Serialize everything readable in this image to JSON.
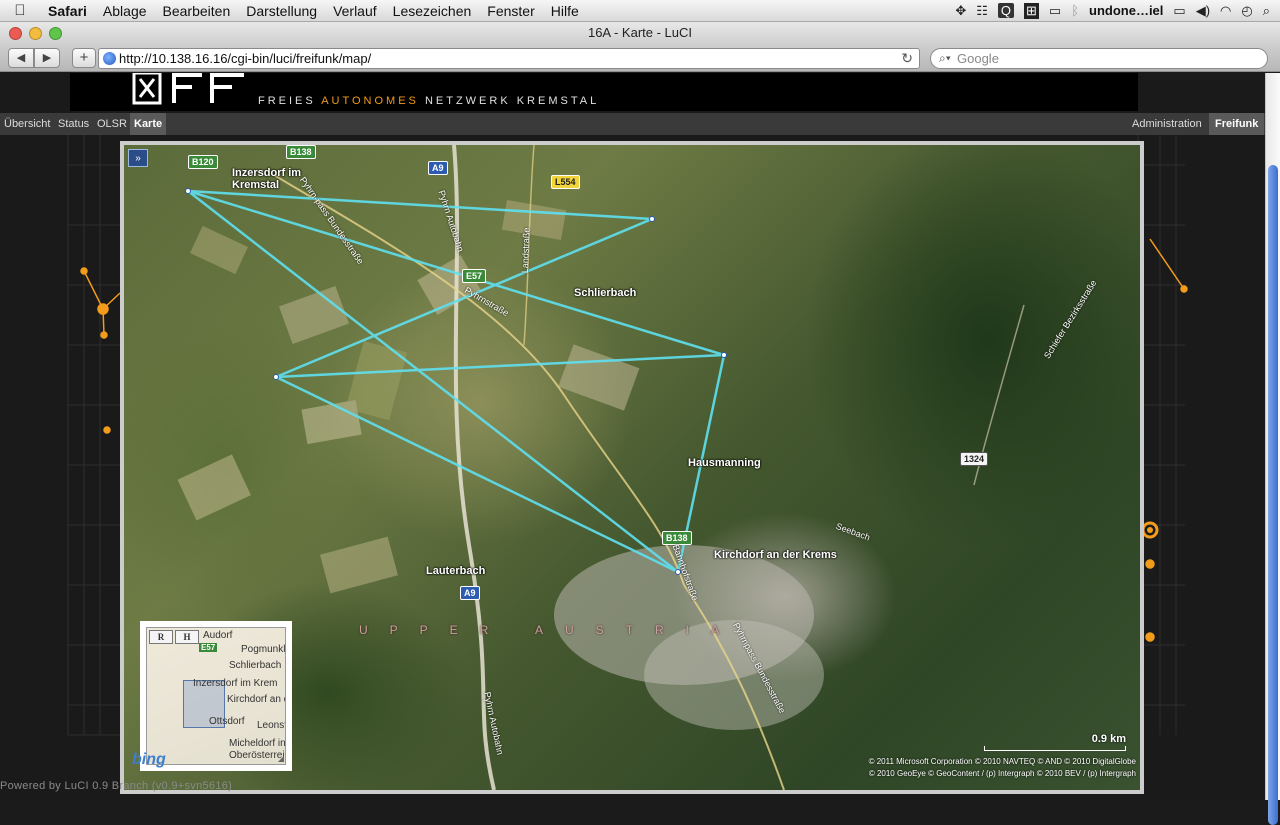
{
  "menubar": {
    "app": "Safari",
    "items": [
      "Ablage",
      "Bearbeiten",
      "Darstellung",
      "Verlauf",
      "Lesezeichen",
      "Fenster",
      "Hilfe"
    ],
    "user": "undone…iel"
  },
  "window": {
    "title": "16A - Karte - LuCI"
  },
  "toolbar": {
    "url": "http://10.138.16.16/cgi-bin/luci/freifunk/map/",
    "search_placeholder": "Google"
  },
  "header": {
    "tagline_part1": "FREIES ",
    "tagline_accent": "AUTONOMES",
    "tagline_part2": " NETZWERK KREMSTAL"
  },
  "nav": {
    "left": [
      "Übersicht",
      "Status",
      "OLSR",
      "Karte"
    ],
    "active": "Karte",
    "right_admin": "Administration",
    "right_freifunk": "Freifunk"
  },
  "map": {
    "layer_toggle": "»",
    "places": [
      {
        "id": "inzersdorf",
        "text": "Inzersdorf im Kremstal"
      },
      {
        "id": "schlierbach",
        "text": "Schlierbach"
      },
      {
        "id": "hausmanning",
        "text": "Hausmanning"
      },
      {
        "id": "kirchdorf",
        "text": "Kirchdorf an der Krems"
      },
      {
        "id": "lauterbach",
        "text": "Lauterbach"
      }
    ],
    "region": "UPPER AUSTRIA",
    "shields": [
      "B120",
      "B138",
      "A9",
      "L554",
      "E57",
      "B138",
      "1324",
      "A9"
    ],
    "roads": [
      "Pyhrn-pass Bundesstraße",
      "Pyhrn Autobahn",
      "Landstraße",
      "Pyhrnstraße",
      "Bahnhofstraße",
      "Pyhrnpass Bundesstraße",
      "Schiefer Bezirksstraße",
      "Seebach",
      "Pyhrn Autobahn"
    ],
    "scale": "0.9 km",
    "attribution_line1": "© 2011 Microsoft Corporation   © 2010 NAVTEQ   © AND   © 2010 DigitalGlobe",
    "attribution_line2": "© 2010 GeoEye   © GeoContent / (p) Intergraph   © 2010 BEV / (p) Intergraph",
    "logo": "bing",
    "link_color": "#5fe0f0"
  },
  "overview": {
    "road_btn": "R",
    "hybrid_btn": "H",
    "shield": "E57",
    "labels": [
      "Audorf",
      "Pogmunkl",
      "Schlierbach",
      "Inzersdorf im Krem",
      "Kirchdorf an d",
      "Ottsdorf",
      "Leonst",
      "Micheldorf in",
      "Oberösterrei"
    ]
  },
  "footer": {
    "text": "Powered by LuCI 0.9 Branch (v0.9+svn5616)"
  }
}
